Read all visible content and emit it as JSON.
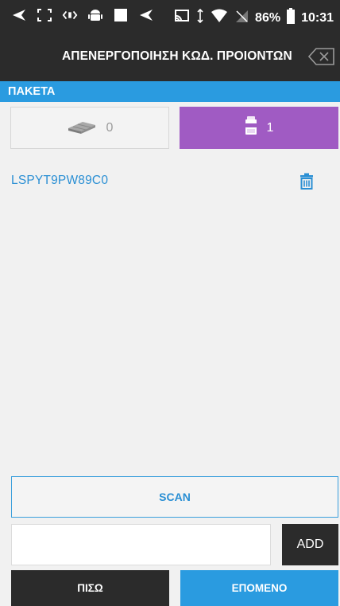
{
  "status_bar": {
    "left_icons": [
      "back-arrow-icon",
      "screen-expand-icon",
      "sound-icon",
      "android-icon",
      "square-icon",
      "back-arrow-icon"
    ],
    "battery": "86%",
    "time": "10:31"
  },
  "toolbar": {
    "title": "ΑΠΕΝΕΡΓΟΠΟΙΗΣΗ ΚΩΔ. ΠΡΟΙΟΝΤΩΝ",
    "clear_icon": "backspace-clear-icon"
  },
  "section": {
    "header": "ΠΑΚΕΤΑ"
  },
  "segments": {
    "packages_count": "0",
    "cigarettes_count": "1",
    "selected": "cigarettes",
    "selected_color": "#a05bc3"
  },
  "items": [
    {
      "code": "LSPYT9PW89C0"
    }
  ],
  "scan": {
    "label": "SCAN"
  },
  "manual": {
    "input_value": "",
    "input_placeholder": "",
    "add_label": "ADD"
  },
  "footer": {
    "back_label": "ΠΙΣΩ",
    "next_label": "ΕΠΟΜΕΝΟ"
  },
  "colors": {
    "accent": "#2a9be0",
    "dark": "#2b2b2b",
    "purple": "#a05bc3",
    "link": "#2a8fd4"
  }
}
